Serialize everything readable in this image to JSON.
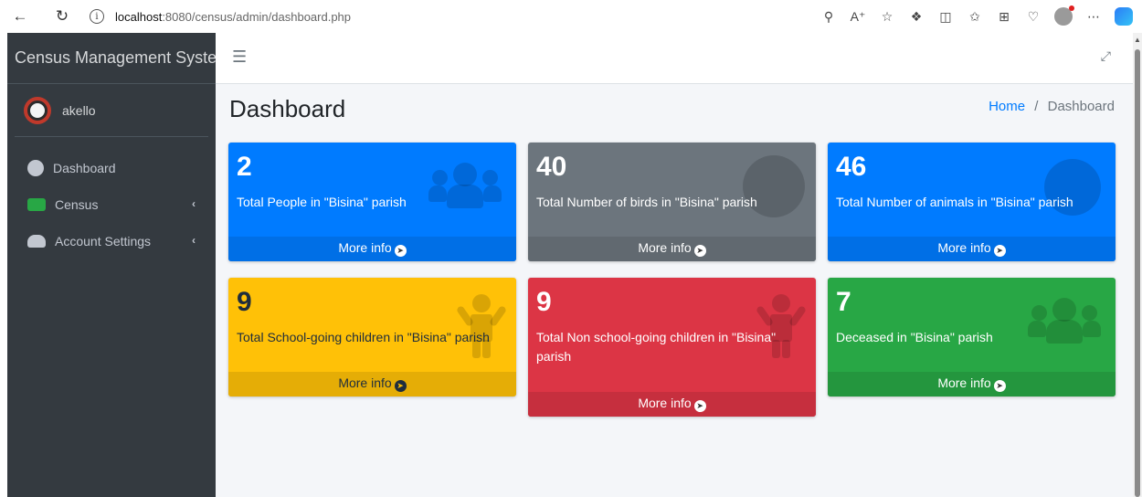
{
  "browser": {
    "url_host": "localhost",
    "url_path": ":8080/census/admin/dashboard.php",
    "toolbar_icons": [
      "key-icon",
      "read-aloud-icon",
      "favorite-star-icon",
      "extensions-icon",
      "split-screen-icon",
      "favorites-icon",
      "collections-icon",
      "health-icon",
      "profile-icon",
      "more-icon",
      "copilot-icon"
    ]
  },
  "sidebar": {
    "brand": "Census Management System",
    "user": "akello",
    "items": [
      {
        "label": "Dashboard",
        "has_chevron": false
      },
      {
        "label": "Census",
        "has_chevron": true
      },
      {
        "label": "Account Settings",
        "has_chevron": true
      }
    ]
  },
  "header": {
    "title": "Dashboard",
    "breadcrumb_home": "Home",
    "breadcrumb_separator": "/",
    "breadcrumb_current": "Dashboard"
  },
  "boxes": [
    {
      "value": "2",
      "label": "Total People in \"Bisina\" parish",
      "footer": "More info",
      "color": "#007bff",
      "icon": "users-icon"
    },
    {
      "value": "40",
      "label": "Total Number of birds in \"Bisina\" parish",
      "footer": "More info",
      "color": "#6c757d",
      "icon": "circle-icon"
    },
    {
      "value": "46",
      "label": "Total Number of animals in \"Bisina\" parish",
      "footer": "More info",
      "color": "#007bff",
      "icon": "circle-icon"
    },
    {
      "value": "9",
      "label": "Total School-going children in \"Bisina\" parish",
      "footer": "More info",
      "color": "#ffc107",
      "icon": "child-icon"
    },
    {
      "value": "9",
      "label": "Total Non school-going children in \"Bisina\" parish",
      "footer": "More info",
      "color": "#dc3545",
      "icon": "child-icon"
    },
    {
      "value": "7",
      "label": "Deceased in \"Bisina\" parish",
      "footer": "More info",
      "color": "#28a745",
      "icon": "users-icon"
    }
  ]
}
